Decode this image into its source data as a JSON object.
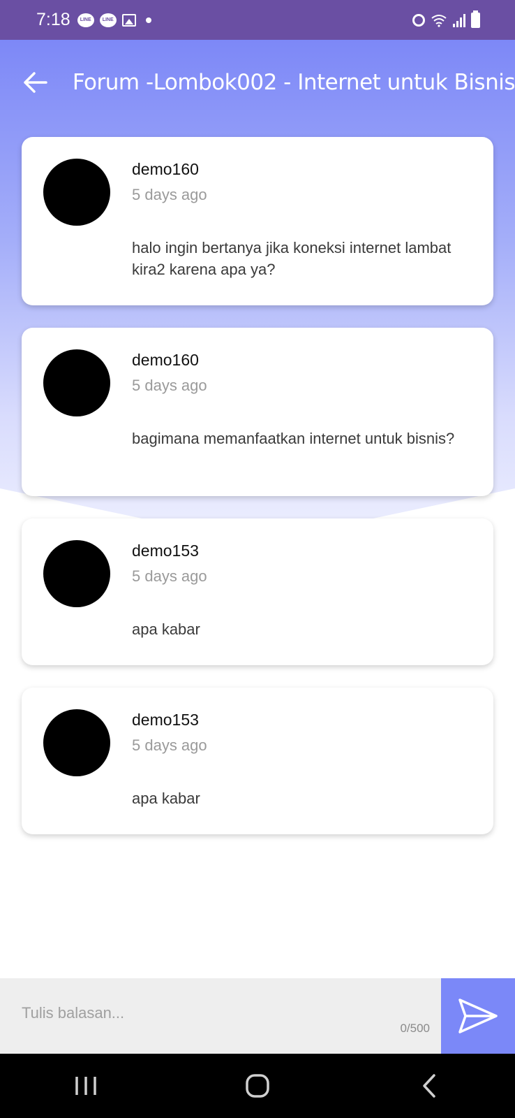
{
  "status_bar": {
    "time": "7:18",
    "left_icons": [
      "line-icon",
      "line-icon",
      "gallery-icon",
      "notification-dot-icon"
    ],
    "right_icons": [
      "alarm-icon",
      "wifi-icon",
      "signal-icon",
      "battery-icon"
    ],
    "line_label": "LINE"
  },
  "app_bar": {
    "title": "Forum -Lombok002 - Internet untuk Bisnis",
    "back_icon": "arrow-left-icon"
  },
  "posts": [
    {
      "author": "demo160",
      "time": "5 days ago",
      "text": "halo ingin bertanya jika koneksi internet lambat kira2 karena apa ya?"
    },
    {
      "author": "demo160",
      "time": "5 days ago",
      "text": "bagimana memanfaatkan internet untuk bisnis?"
    },
    {
      "author": "demo153",
      "time": "5 days ago",
      "text": "apa kabar"
    },
    {
      "author": "demo153",
      "time": "5 days ago",
      "text": "apa kabar"
    }
  ],
  "reply": {
    "placeholder": "Tulis balasan...",
    "value": "",
    "counter": "0/500",
    "send_icon": "send-icon"
  },
  "nav": {
    "recents_icon": "recents-icon",
    "home_icon": "home-icon",
    "back_icon": "back-icon"
  },
  "colors": {
    "status_bar": "#6a4fa3",
    "header_gradient_top": "#7d88f7",
    "send_button": "#7b88f8",
    "reply_bar": "#eeeeee"
  }
}
